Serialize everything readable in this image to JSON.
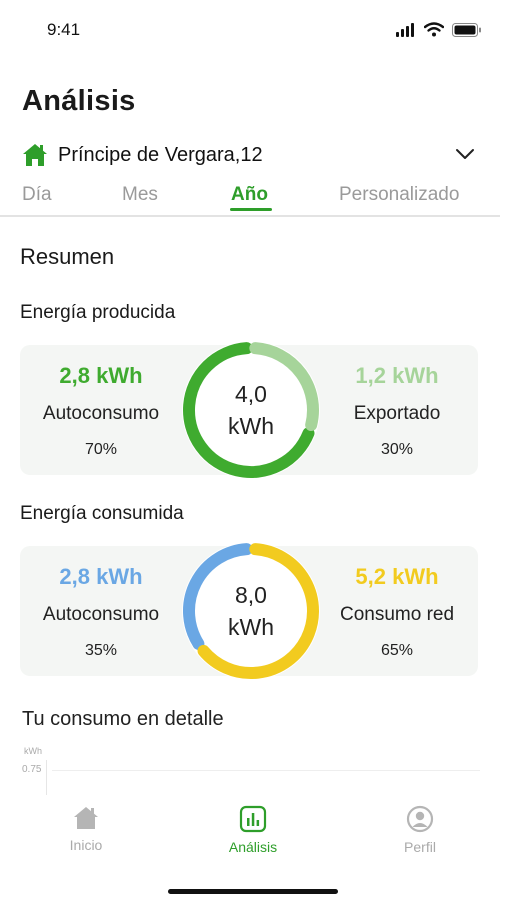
{
  "status_bar": {
    "time": "9:41"
  },
  "page": {
    "title": "Análisis"
  },
  "location": {
    "name": "Príncipe de Vergara,12",
    "icon": "home-icon"
  },
  "tabs": [
    {
      "label": "Día",
      "active": false
    },
    {
      "label": "Mes",
      "active": false
    },
    {
      "label": "Año",
      "active": true
    },
    {
      "label": "Personalizado",
      "active": false
    }
  ],
  "summary": {
    "title": "Resumen"
  },
  "produced": {
    "title": "Energía producida",
    "total_value": "4,0",
    "total_unit": "kWh",
    "left": {
      "value": "2,8 kWh",
      "label": "Autoconsumo",
      "percent": "70%",
      "fraction": 0.7,
      "color": "#3fab2f"
    },
    "right": {
      "value": "1,2 kWh",
      "label": "Exportado",
      "percent": "30%",
      "fraction": 0.3,
      "color": "#a6d49a"
    }
  },
  "consumed": {
    "title": "Energía consumida",
    "total_value": "8,0",
    "total_unit": "kWh",
    "left": {
      "value": "2,8 kWh",
      "label": "Autoconsumo",
      "percent": "35%",
      "fraction": 0.35,
      "color": "#6aa7e4"
    },
    "right": {
      "value": "5,2 kWh",
      "label": "Consumo red",
      "percent": "65%",
      "fraction": 0.65,
      "color": "#f2cb1f"
    }
  },
  "detail": {
    "title": "Tu consumo en detalle",
    "unit": "kWh",
    "tick": "0.75"
  },
  "bottom_nav": [
    {
      "label": "Inicio",
      "icon": "home-icon",
      "active": false
    },
    {
      "label": "Análisis",
      "icon": "chart-icon",
      "active": true
    },
    {
      "label": "Perfil",
      "icon": "user-icon",
      "active": false
    }
  ],
  "colors": {
    "accent": "#2e9e2a",
    "inactive": "#aaaaaa"
  }
}
